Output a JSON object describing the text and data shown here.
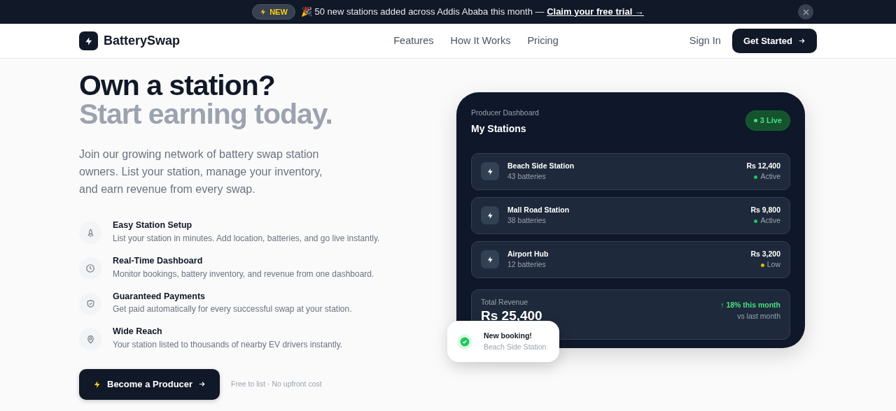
{
  "announcement": {
    "badge": "NEW",
    "emoji": "🎉",
    "message": "50 new stations added across Addis Ababa this month —",
    "link": "Claim your free trial →"
  },
  "navbar": {
    "brand": "BatterySwap",
    "links": [
      "Features",
      "How It Works",
      "Pricing"
    ],
    "sign_in": "Sign In",
    "cta": "Get Started"
  },
  "hero": {
    "title_line_1": "Own a station?",
    "title_line_2": "Start earning today.",
    "lead": "Join our growing network of battery swap station owners. List your station, manage your inventory, and earn revenue from every swap.",
    "features": [
      {
        "kind": "rocket",
        "title": "Easy Station Setup",
        "text": "List your station in minutes. Add location, batteries, and go live instantly."
      },
      {
        "kind": "clock",
        "title": "Real-Time Dashboard",
        "text": "Monitor bookings, battery inventory, and revenue from one dashboard."
      },
      {
        "kind": "shield",
        "title": "Guaranteed Payments",
        "text": "Get paid automatically for every successful swap at your station."
      },
      {
        "kind": "pin",
        "title": "Wide Reach",
        "text": "Your station listed to thousands of nearby EV drivers instantly."
      }
    ],
    "button": "Become a Producer",
    "note": "Free to list · No upfront cost"
  },
  "dashboard": {
    "eyebrow": "Producer Dashboard",
    "title": "My Stations",
    "live_badge": "3 Live",
    "stations": [
      {
        "name": "Beach Side Station",
        "batteries": "43 batteries",
        "revenue": "Rs 12,400",
        "status": "Active",
        "color": "#22c55e"
      },
      {
        "name": "Mall Road Station",
        "batteries": "38 batteries",
        "revenue": "Rs 9,800",
        "status": "Active",
        "color": "#22c55e"
      },
      {
        "name": "Airport Hub",
        "batteries": "12 batteries",
        "revenue": "Rs 3,200",
        "status": "Low",
        "color": "#eab308"
      }
    ],
    "total_label": "Total Revenue",
    "total_value": "Rs 25,400",
    "growth": "↑ 18% this month",
    "growth_note": "vs last month"
  },
  "toast": {
    "title": "New booking!",
    "subtitle": "Beach Side Station"
  }
}
